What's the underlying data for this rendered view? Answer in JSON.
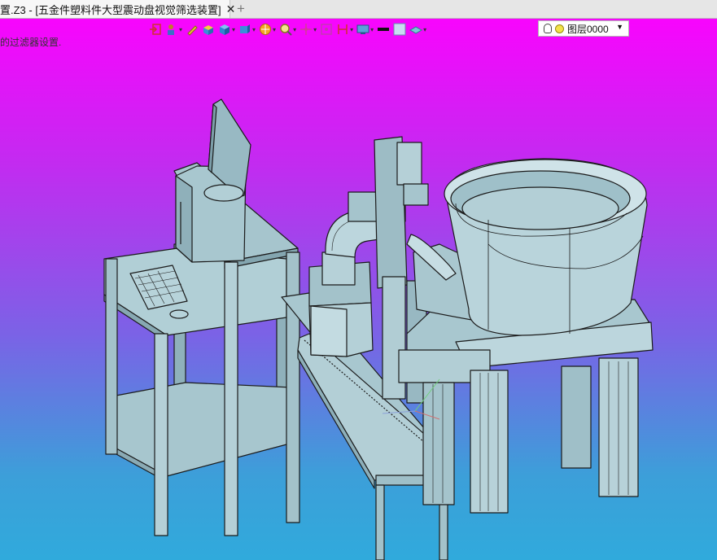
{
  "tab": {
    "title": "置.Z3 - [五金件塑料件大型震动盘视觉筛选装置]",
    "close": "✕"
  },
  "new_tab": "+",
  "status_hint": "的过滤器设置.",
  "layer": {
    "label": "图层0000"
  },
  "toolbar_icons": [
    "exit-sketch-icon",
    "user-icon",
    "pencil-icon",
    "box-material-icon",
    "cube-icon",
    "cube-view-icon",
    "render-sphere-icon",
    "zoom-icon",
    "move-axis-icon",
    "fit-window-icon",
    "dimension-icon",
    "display-icon",
    "line-color-swatch",
    "fill-color-swatch",
    "layer-shape-icon"
  ],
  "colors": {
    "bg_top": "#ff00ff",
    "bg_bottom": "#30aadc",
    "part": "#a9c9d2",
    "part_dark": "#7fa5b1",
    "edge": "#1a1a1a"
  }
}
